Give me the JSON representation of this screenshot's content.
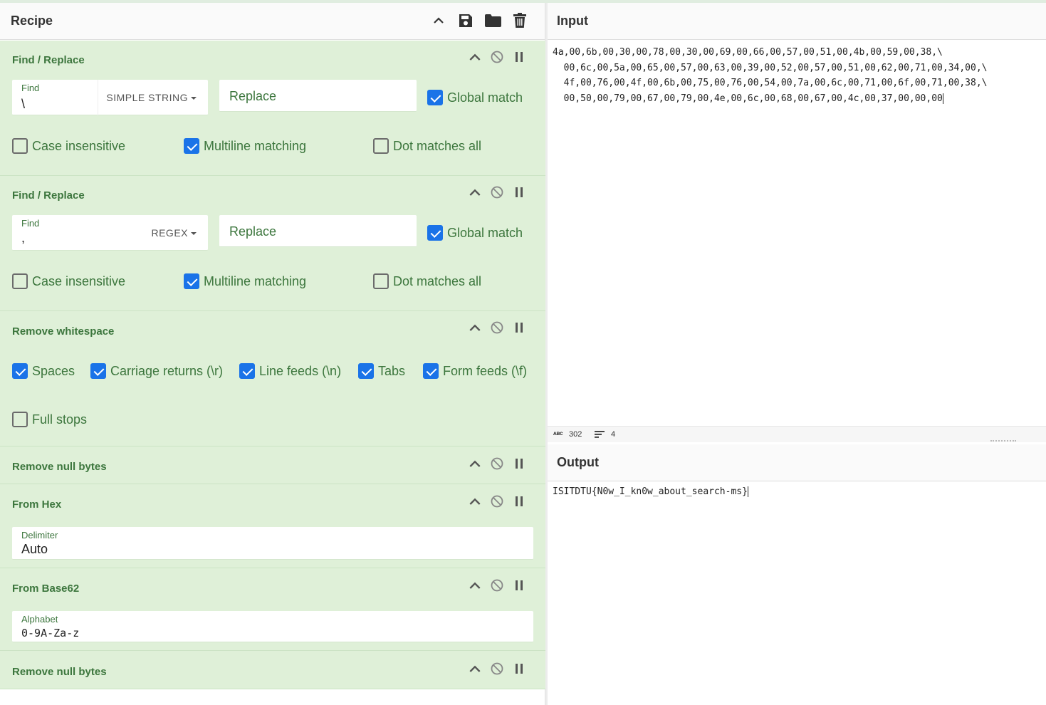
{
  "recipe": {
    "title": "Recipe",
    "header_icons": [
      "chevron-up-icon",
      "save-icon",
      "folder-icon",
      "trash-icon"
    ],
    "operations": [
      {
        "title": "Find / Replace",
        "find_label": "Find",
        "find_value": "\\",
        "find_mode": "SIMPLE STRING",
        "replace_placeholder": "Replace",
        "global_match": {
          "label": "Global match",
          "checked": true
        },
        "case_insensitive": {
          "label": "Case insensitive",
          "checked": false
        },
        "multiline": {
          "label": "Multiline matching",
          "checked": true
        },
        "dot_all": {
          "label": "Dot matches all",
          "checked": false
        }
      },
      {
        "title": "Find / Replace",
        "find_label": "Find",
        "find_value": ",",
        "find_mode": "REGEX",
        "replace_placeholder": "Replace",
        "global_match": {
          "label": "Global match",
          "checked": true
        },
        "case_insensitive": {
          "label": "Case insensitive",
          "checked": false
        },
        "multiline": {
          "label": "Multiline matching",
          "checked": true
        },
        "dot_all": {
          "label": "Dot matches all",
          "checked": false
        }
      },
      {
        "title": "Remove whitespace",
        "options": [
          {
            "label": "Spaces",
            "checked": true
          },
          {
            "label": "Carriage returns (\\r)",
            "checked": true
          },
          {
            "label": "Line feeds (\\n)",
            "checked": true
          },
          {
            "label": "Tabs",
            "checked": true
          },
          {
            "label": "Form feeds (\\f)",
            "checked": true
          },
          {
            "label": "Full stops",
            "checked": false
          }
        ]
      },
      {
        "title": "Remove null bytes"
      },
      {
        "title": "From Hex",
        "field_label": "Delimiter",
        "field_value": "Auto"
      },
      {
        "title": "From Base62",
        "field_label": "Alphabet",
        "field_value": "0-9A-Za-z"
      },
      {
        "title": "Remove null bytes"
      }
    ]
  },
  "input": {
    "title": "Input",
    "lines": [
      "4a,00,6b,00,30,00,78,00,30,00,69,00,66,00,57,00,51,00,4b,00,59,00,38,\\",
      "  00,6c,00,5a,00,65,00,57,00,63,00,39,00,52,00,57,00,51,00,62,00,71,00,34,00,\\",
      "  4f,00,76,00,4f,00,6b,00,75,00,76,00,54,00,7a,00,6c,00,71,00,6f,00,71,00,38,\\",
      "  00,50,00,79,00,67,00,79,00,4e,00,6c,00,68,00,67,00,4c,00,37,00,00,00"
    ],
    "stats": {
      "length_icon": "abc-icon",
      "length": "302",
      "lines_icon": "lines-icon",
      "line_count": "4"
    }
  },
  "output": {
    "title": "Output",
    "text": "ISITDTU{N0w_I_kn0w_about_search-ms}"
  },
  "colors": {
    "op_bg": "#dff0d8",
    "op_text": "#3c763d",
    "checkbox_on": "#1a73e8"
  }
}
